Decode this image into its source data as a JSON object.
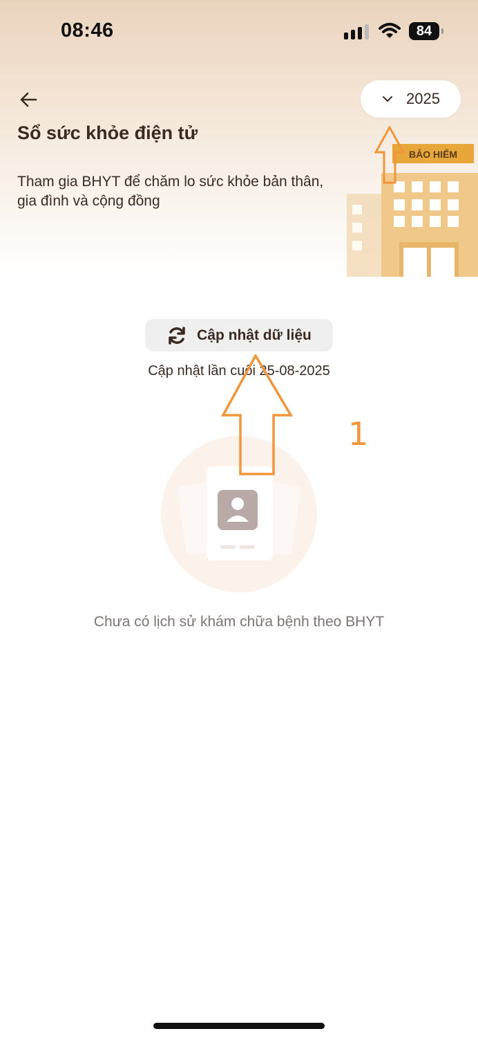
{
  "status_bar": {
    "time": "08:46",
    "battery": "84"
  },
  "header": {
    "title": "Sổ sức khỏe điện tử",
    "description": "Tham gia BHYT để chăm lo sức khỏe bản thân, gia đình và cộng đồng",
    "year_select": {
      "value": "2025"
    },
    "building_sign": "BẢO HIỂM"
  },
  "update": {
    "button_label": "Cập nhật dữ liệu",
    "last_updated": "Cập nhật lần cuối 25-08-2025"
  },
  "empty_state": {
    "message": "Chưa có lịch sử khám chữa bệnh theo BHYT"
  },
  "annotation": {
    "step_number": "1",
    "color": "#f2953a"
  },
  "colors": {
    "accent": "#f2953a",
    "header_top": "#ead3bd",
    "text": "#3a2a22",
    "muted": "#7a7472",
    "building": "#f0c98a",
    "sign": "#e8a73a"
  }
}
